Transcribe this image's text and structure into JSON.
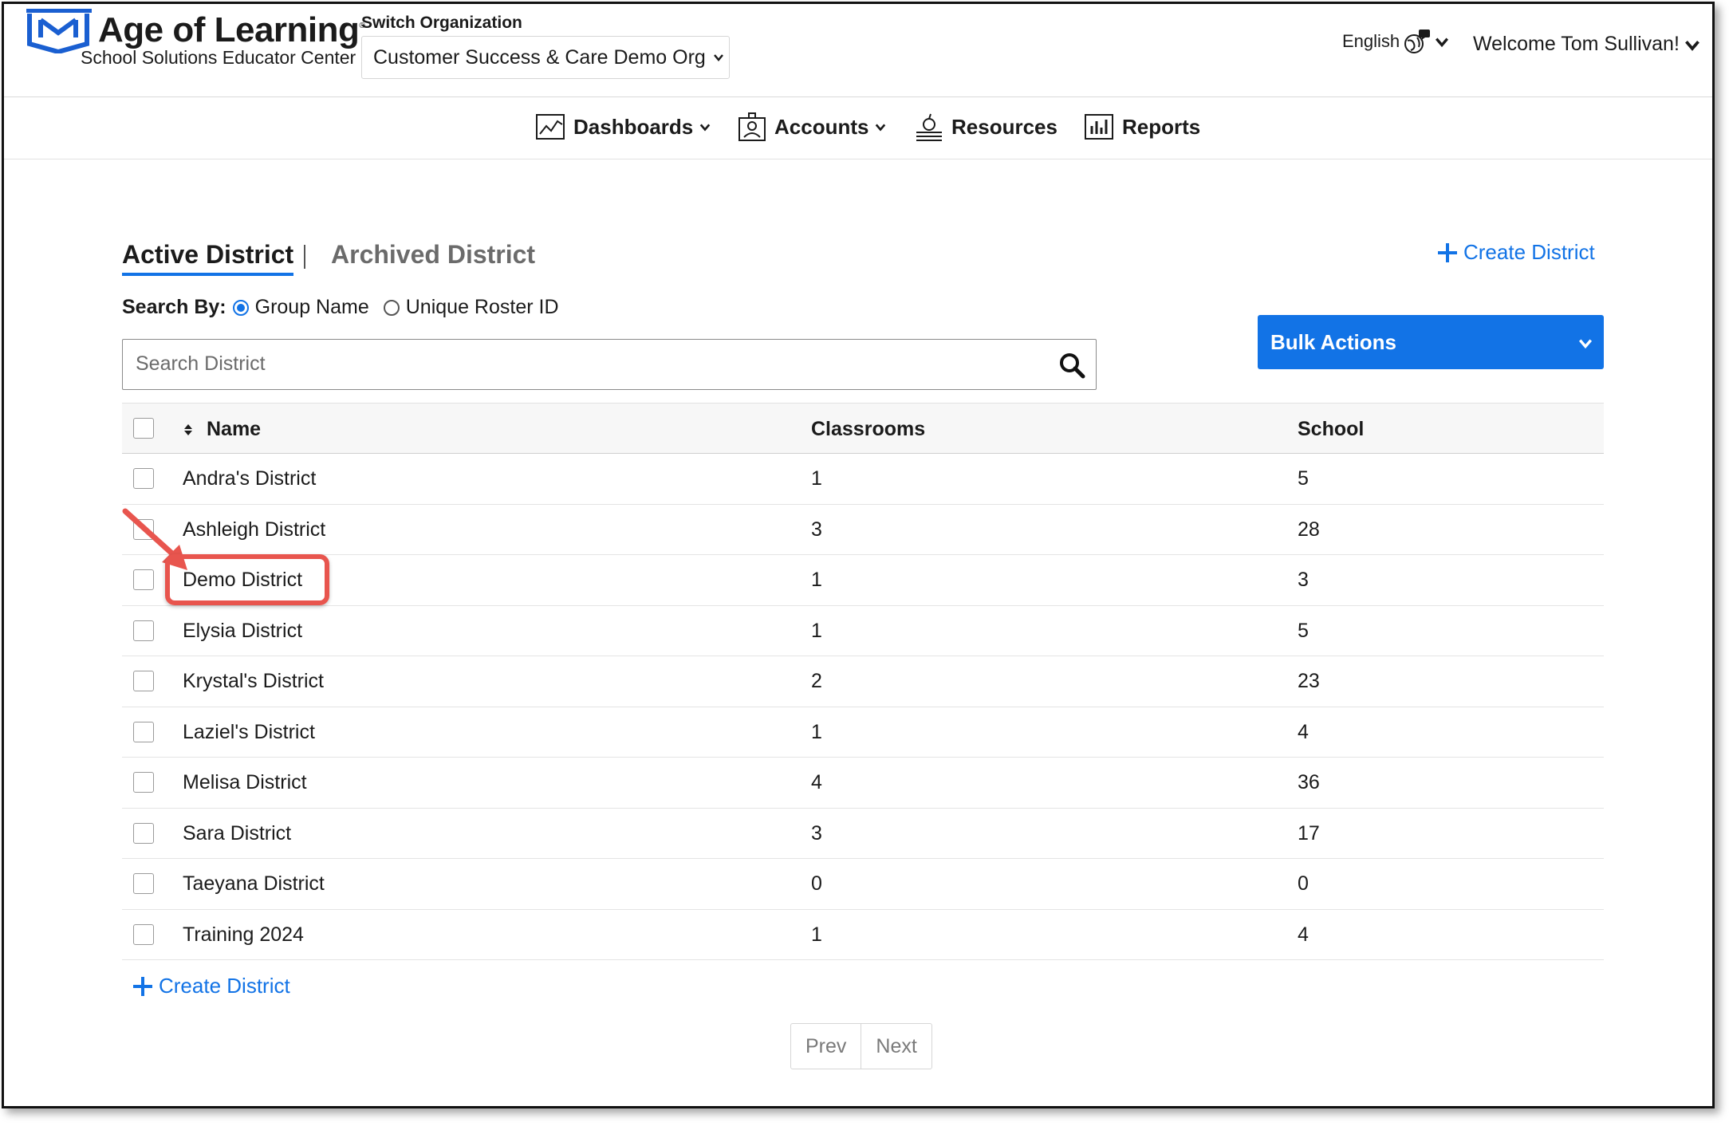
{
  "header": {
    "brand_title": "Age of Learning",
    "brand_sub": "School Solutions Educator Center",
    "switch_label": "Switch Organization",
    "org_value": "Customer Success & Care Demo Org",
    "language": "English",
    "welcome": "Welcome Tom Sullivan!"
  },
  "nav": [
    {
      "label": "Dashboards",
      "icon": "chart-icon"
    },
    {
      "label": "Accounts",
      "icon": "accounts-icon"
    },
    {
      "label": "Resources",
      "icon": "resources-icon"
    },
    {
      "label": "Reports",
      "icon": "reports-icon"
    }
  ],
  "tabs": {
    "active": "Active District",
    "archived": "Archived District"
  },
  "create_label": "Create District",
  "search_by": {
    "label": "Search By:",
    "options": [
      "Group Name",
      "Unique Roster ID"
    ],
    "selected": "Group Name"
  },
  "search": {
    "placeholder": "Search District"
  },
  "bulk_actions": "Bulk Actions",
  "table": {
    "headers": {
      "name": "Name",
      "classrooms": "Classrooms",
      "school": "School"
    },
    "rows": [
      {
        "name": "Andra's District",
        "classrooms": "1",
        "school": "5"
      },
      {
        "name": "Ashleigh District",
        "classrooms": "3",
        "school": "28"
      },
      {
        "name": "Demo District",
        "classrooms": "1",
        "school": "3"
      },
      {
        "name": "Elysia District",
        "classrooms": "1",
        "school": "5"
      },
      {
        "name": "Krystal's District",
        "classrooms": "2",
        "school": "23"
      },
      {
        "name": "Laziel's District",
        "classrooms": "1",
        "school": "4"
      },
      {
        "name": "Melisa District",
        "classrooms": "4",
        "school": "36"
      },
      {
        "name": "Sara District",
        "classrooms": "3",
        "school": "17"
      },
      {
        "name": "Taeyana District",
        "classrooms": "0",
        "school": "0"
      },
      {
        "name": "Training 2024",
        "classrooms": "1",
        "school": "4"
      }
    ]
  },
  "pager": {
    "prev": "Prev",
    "next": "Next"
  },
  "colors": {
    "accent": "#1273e6",
    "annotation": "#e8554e"
  }
}
